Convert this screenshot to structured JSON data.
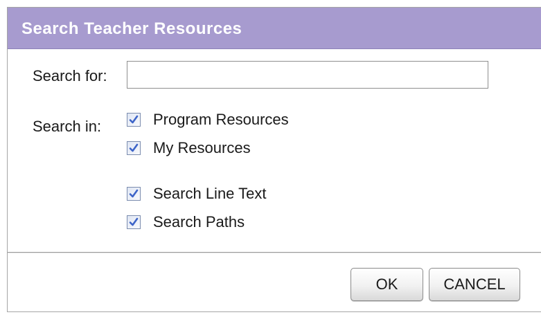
{
  "dialog": {
    "title": "Search Teacher Resources"
  },
  "search_for": {
    "label": "Search for:",
    "value": "",
    "placeholder": ""
  },
  "search_in": {
    "label": "Search in:",
    "options": [
      {
        "label": "Program Resources",
        "checked": true
      },
      {
        "label": "My Resources",
        "checked": true
      },
      {
        "label": "Search Line Text",
        "checked": true
      },
      {
        "label": "Search Paths",
        "checked": true
      }
    ]
  },
  "buttons": {
    "ok_label": "OK",
    "cancel_label": "CANCEL"
  },
  "colors": {
    "titlebar": "#a79bcf",
    "checkmark": "#3d64c8"
  },
  "icons": {
    "checkbox_checked": "checkmark-icon"
  }
}
